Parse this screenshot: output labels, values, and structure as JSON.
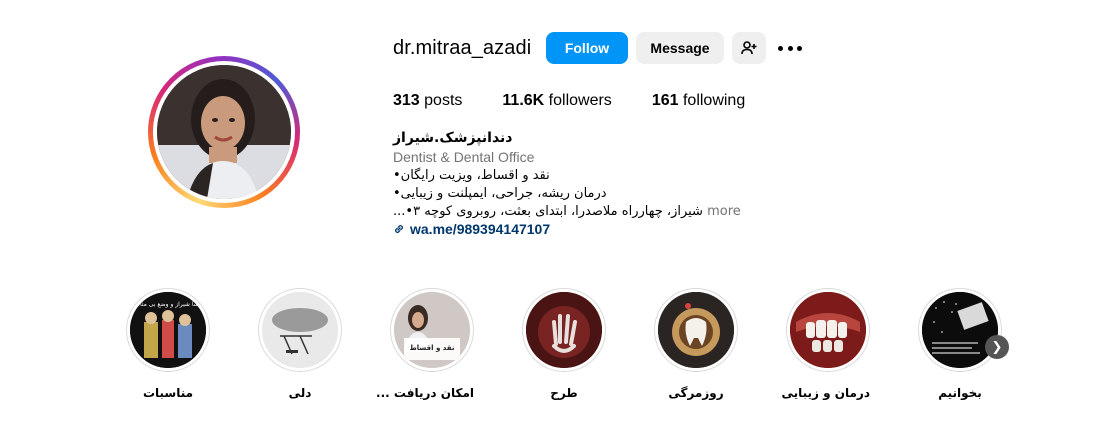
{
  "profile": {
    "username": "dr.mitraa_azadi",
    "follow_label": "Follow",
    "message_label": "Message",
    "stats": {
      "posts_count": "313",
      "posts_label": "posts",
      "followers_count": "11.6K",
      "followers_label": "followers",
      "following_count": "161",
      "following_label": "following"
    },
    "bio": {
      "name": "دندانپزشک.شیراز",
      "category": "Dentist & Dental Office",
      "line1": "نقد و اقساط، ویزیت رایگان•",
      "line2": "درمان ریشه، جراحی، ایمپلنت و زیبایی•",
      "line3": "شیراز، چهارراه ملاصدرا، ابتدای بعثت، روبروی کوچه ۳•...",
      "more_label": "more",
      "link": "wa.me/989394147107"
    }
  },
  "highlights": [
    {
      "label": "مناسبات",
      "image_text": "خوشا شیراز و وضع بی مثالش"
    },
    {
      "label": "دلی",
      "image_text": ""
    },
    {
      "label": "امکان دریافت ...",
      "image_text": "نقد و اقساط"
    },
    {
      "label": "طرح",
      "image_text": ""
    },
    {
      "label": "روزمرگی",
      "image_text": ""
    },
    {
      "label": "درمان و زیبایی",
      "image_text": ""
    },
    {
      "label": "بخوانیم",
      "image_text": ""
    }
  ],
  "colors": {
    "primary_button": "#0095f6",
    "secondary_button": "#efefef",
    "link": "#00376b",
    "muted": "#737373"
  },
  "icons": [
    "add-person-icon",
    "more-options-icon",
    "link-icon",
    "chevron-right-icon"
  ]
}
